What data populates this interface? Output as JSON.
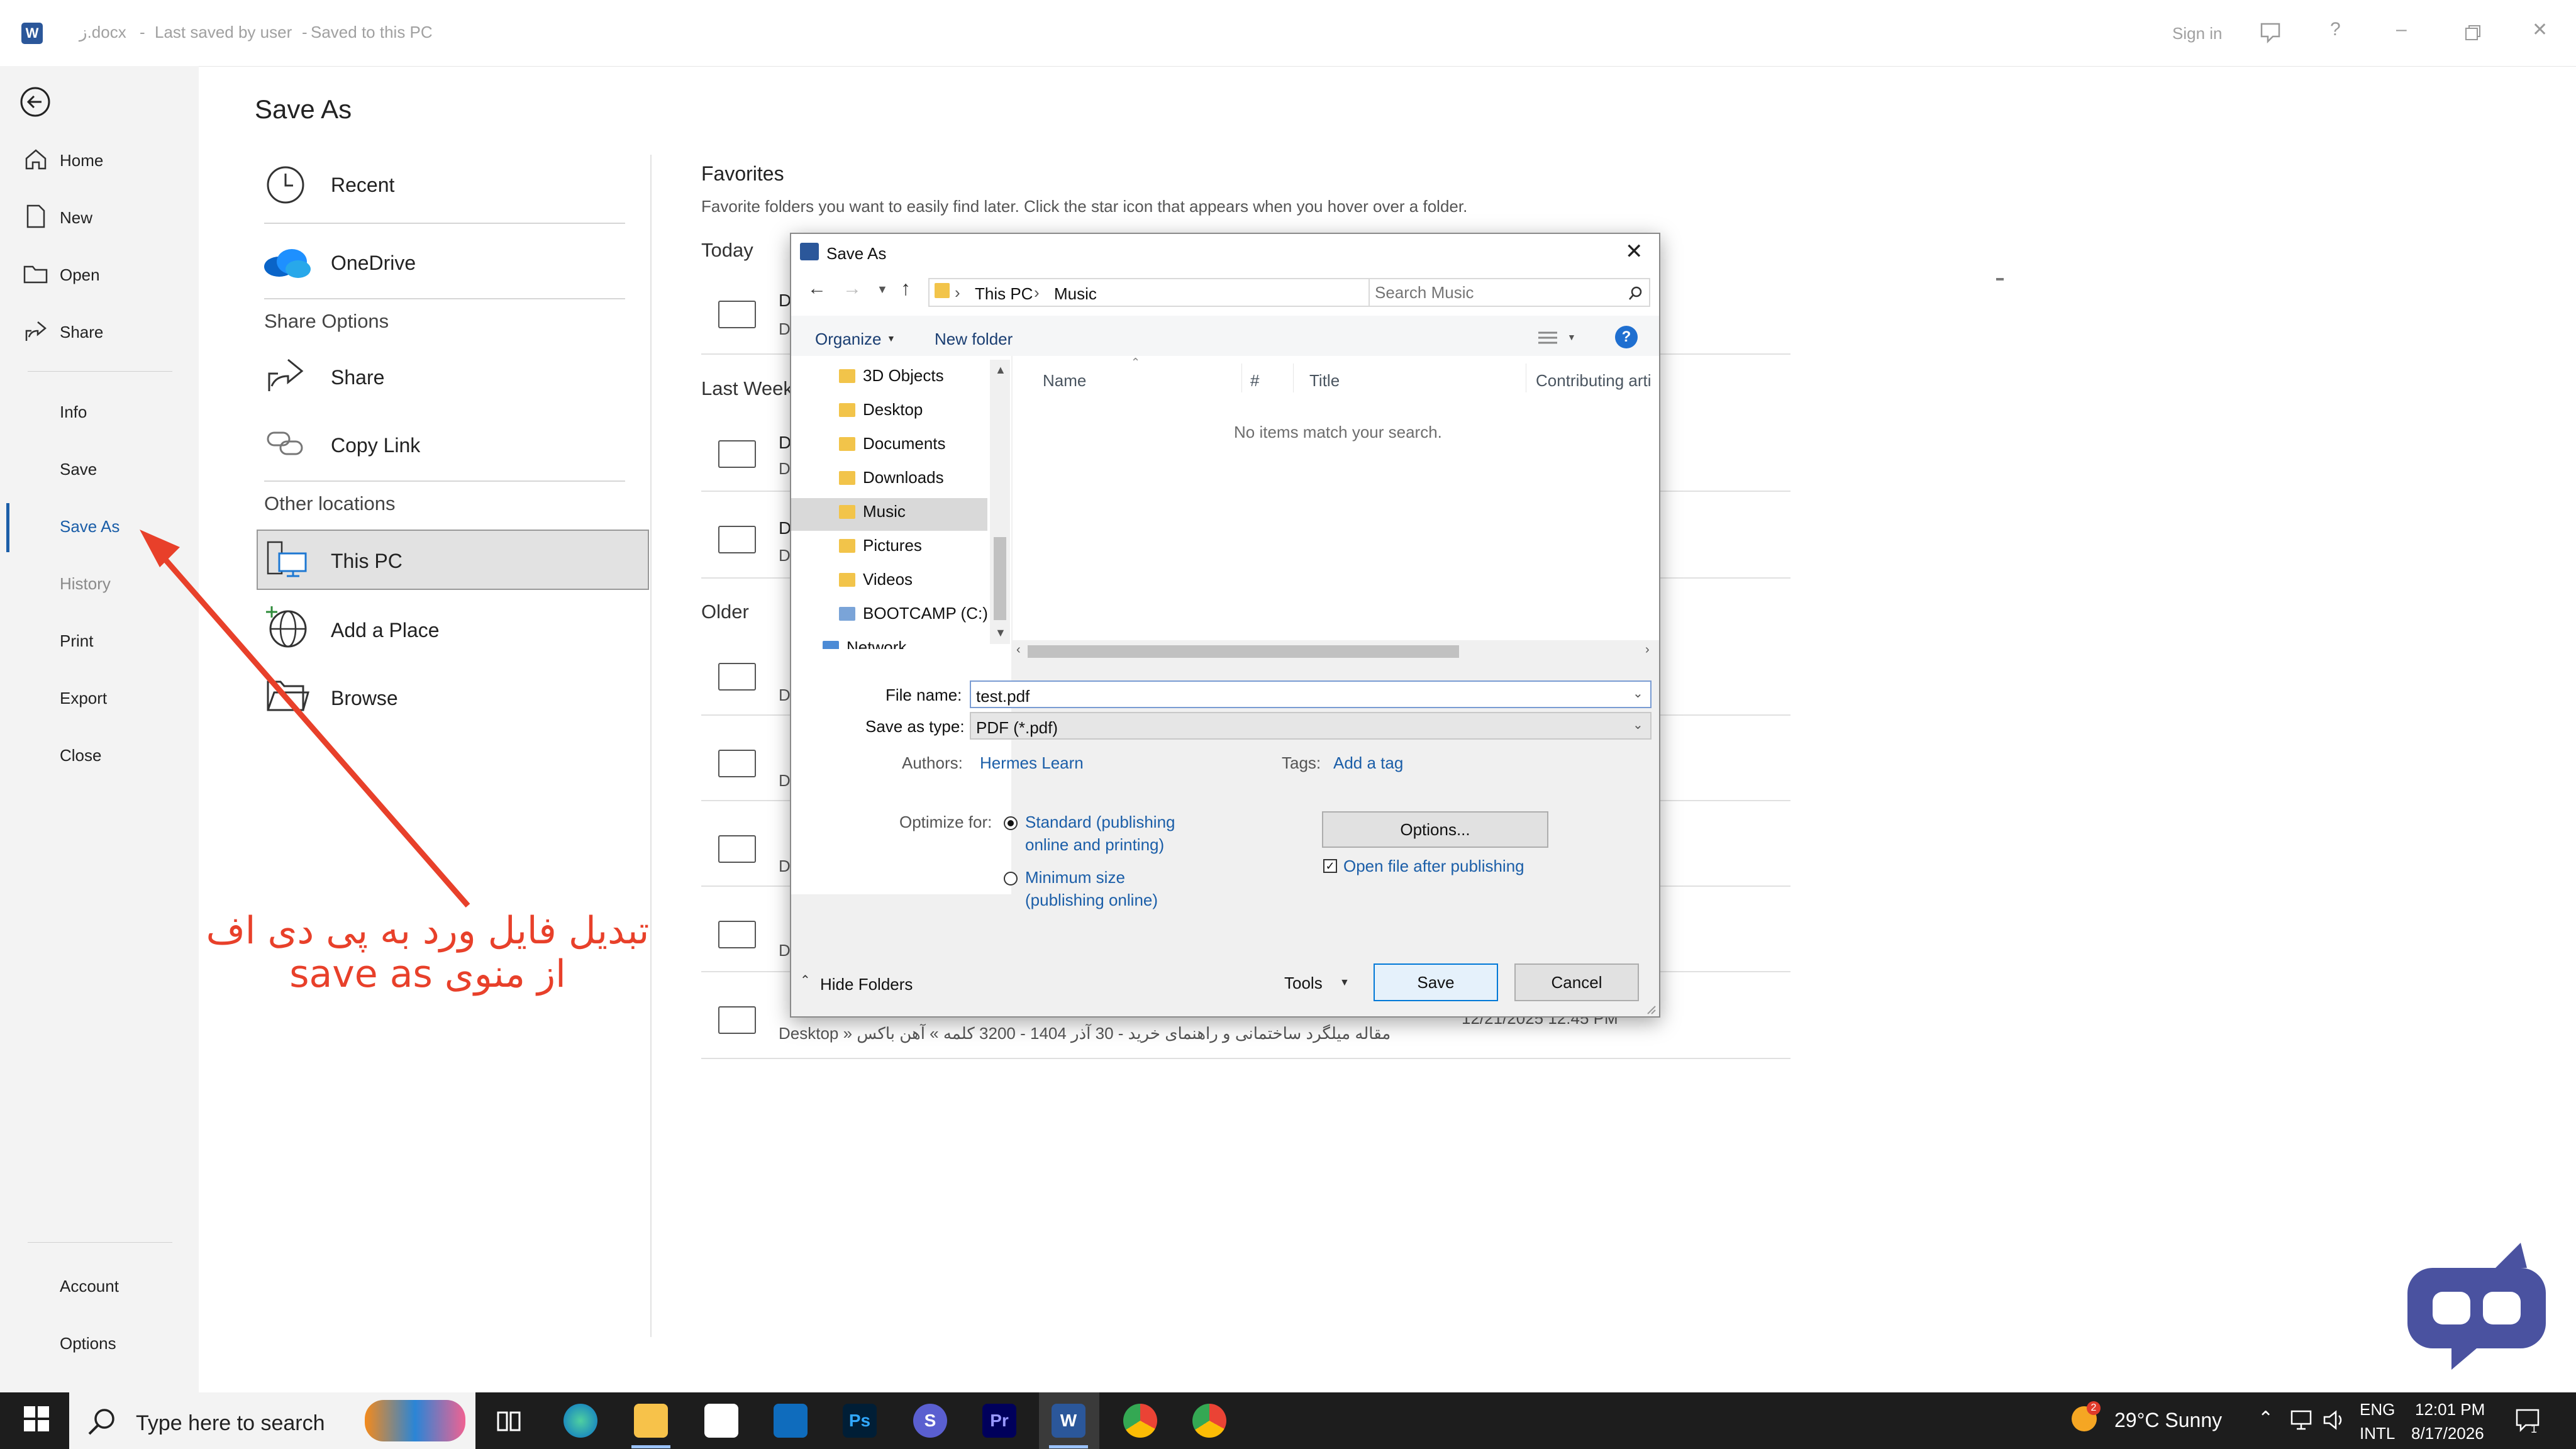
{
  "titlebar": {
    "app_icon": "W",
    "doc_name": "ز.docx",
    "last_saved": "Last saved by user",
    "saved_to": "Saved to this PC",
    "sign_in": "Sign in"
  },
  "nav": {
    "back_icon": "back-arrow-icon",
    "top_items": [
      {
        "label": "Home",
        "icon": "home-icon"
      },
      {
        "label": "New",
        "icon": "new-doc-icon"
      },
      {
        "label": "Open",
        "icon": "open-folder-icon"
      },
      {
        "label": "Share",
        "icon": "share-icon"
      }
    ],
    "items": [
      "Info",
      "Save",
      "Save As",
      "History",
      "Print",
      "Export",
      "Close"
    ],
    "bottom_items": [
      "Account",
      "Options"
    ]
  },
  "saveas": {
    "title": "Save As",
    "recent": "Recent",
    "onedrive": "OneDrive",
    "share_options": "Share Options",
    "share": "Share",
    "copy_link": "Copy Link",
    "other_locations": "Other locations",
    "this_pc": "This PC",
    "add_place": "Add a Place",
    "browse": "Browse"
  },
  "favorites": {
    "title": "Favorites",
    "desc": "Favorite folders you want to easily find later. Click the star icon that appears when you hover over a folder.",
    "today": "Today",
    "last_week": "Last Week",
    "older": "Older",
    "row_letter": "D",
    "last_row_path": "Desktop » مقاله میلگرد ساختمانی و راهنمای خرید - 30 آذر 1404 - 3200 کلمه » آهن باکس",
    "last_row_date": "12/21/2025 12:45 PM"
  },
  "dialog": {
    "title": "Save As",
    "path": [
      "This PC",
      "Music"
    ],
    "search_placeholder": "Search Music",
    "organize": "Organize",
    "new_folder": "New folder",
    "tree": [
      "3D Objects",
      "Desktop",
      "Documents",
      "Downloads",
      "Music",
      "Pictures",
      "Videos",
      "BOOTCAMP (C:)",
      "Network"
    ],
    "columns": [
      "Name",
      "#",
      "Title",
      "Contributing arti"
    ],
    "empty_msg": "No items match your search.",
    "file_name_label": "File name:",
    "file_name_value": "test.pdf",
    "save_type_label": "Save as type:",
    "save_type_value": "PDF (*.pdf)",
    "authors_label": "Authors:",
    "authors_value": "Hermes Learn",
    "tags_label": "Tags:",
    "tags_value": "Add a tag",
    "optimize_label": "Optimize for:",
    "opt_standard_1": "Standard (publishing",
    "opt_standard_2": "online and printing)",
    "opt_minimum_1": "Minimum size",
    "opt_minimum_2": "(publishing online)",
    "options_btn": "Options...",
    "open_after": "Open file after publishing",
    "hide_folders": "Hide Folders",
    "tools": "Tools",
    "save": "Save",
    "cancel": "Cancel"
  },
  "annotation": {
    "line1": "تبدیل فایل ورد به پی دی اف",
    "line2": "از منوی save as",
    "color": "#e8402a"
  },
  "taskbar": {
    "search_placeholder": "Type here to search",
    "weather": "29°C  Sunny",
    "weather_badge": "2",
    "lang1": "ENG",
    "lang2": "INTL",
    "time": "12:01 PM",
    "date": "8/17/2026",
    "notif_count": "1"
  }
}
